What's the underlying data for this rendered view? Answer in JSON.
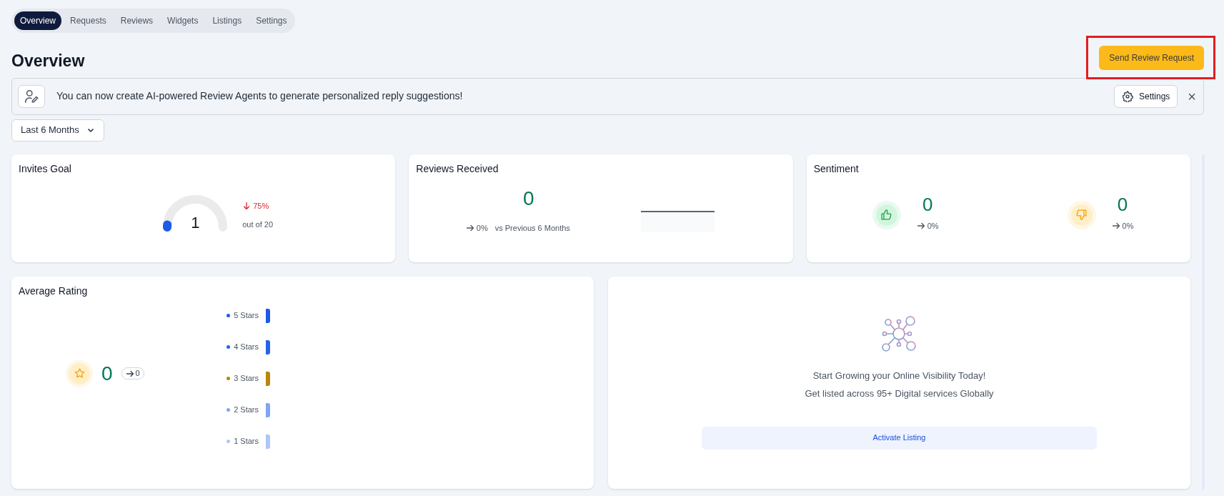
{
  "tabs": [
    {
      "label": "Overview",
      "selected": true
    },
    {
      "label": "Requests",
      "selected": false
    },
    {
      "label": "Reviews",
      "selected": false
    },
    {
      "label": "Widgets",
      "selected": false
    },
    {
      "label": "Listings",
      "selected": false
    },
    {
      "label": "Settings",
      "selected": false
    }
  ],
  "page_title": "Overview",
  "send_button": {
    "label": "Send Review Request",
    "highlighted": true
  },
  "banner": {
    "message": "You can now create AI-powered Review Agents to generate personalized reply suggestions!",
    "settings_label": "Settings",
    "close": "×"
  },
  "period_dropdown": {
    "value": "Last 6 Months"
  },
  "invites_goal": {
    "title": "Invites Goal",
    "value": "1",
    "change": "75%",
    "goal": "out of 20"
  },
  "reviews_received": {
    "title": "Reviews Received",
    "value": "0",
    "change": "0%",
    "comparison": "vs Previous 6 Months"
  },
  "sentiment": {
    "title": "Sentiment",
    "items": [
      {
        "kind": "positive",
        "value": "0",
        "change": "0%"
      },
      {
        "kind": "negative",
        "value": "0",
        "change": "0%"
      }
    ]
  },
  "average_rating": {
    "title": "Average Rating",
    "value": "0",
    "change": "0",
    "distribution": [
      {
        "label": "5 Stars",
        "color": "#1d5ae8"
      },
      {
        "label": "4 Stars",
        "color": "#2563eb"
      },
      {
        "label": "3 Stars",
        "color": "#b7860b"
      },
      {
        "label": "2 Stars",
        "color": "#7fa6f5"
      },
      {
        "label": "1 Stars",
        "color": "#aec6f8"
      }
    ]
  },
  "listings_promo": {
    "headline": "Start Growing your Online Visibility Today!",
    "subline": "Get listed across 95+ Digital services Globally",
    "button": "Activate Listing"
  }
}
